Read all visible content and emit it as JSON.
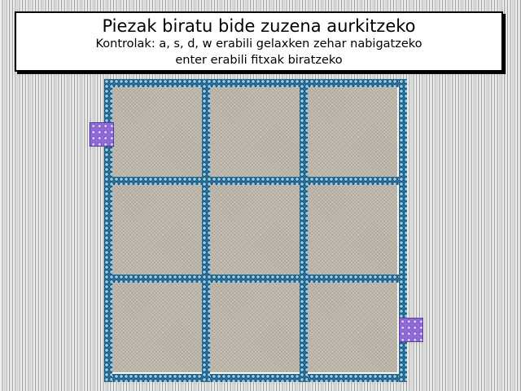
{
  "instructions": {
    "title": "Piezak biratu bide zuzena aurkitzeko",
    "line1": "Kontrolak: a, s, d, w erabili gelaxken zehar nabigatzeko",
    "line2": "enter erabili fitxak biratzeko"
  },
  "board": {
    "rows": 3,
    "cols": 3
  },
  "colors": {
    "rail": "#2c6f97",
    "tile": "#bdb6aa",
    "marker": "#8f6bd8"
  },
  "markers": {
    "start_icon": "purple-gem-block",
    "end_icon": "purple-gem-block"
  }
}
